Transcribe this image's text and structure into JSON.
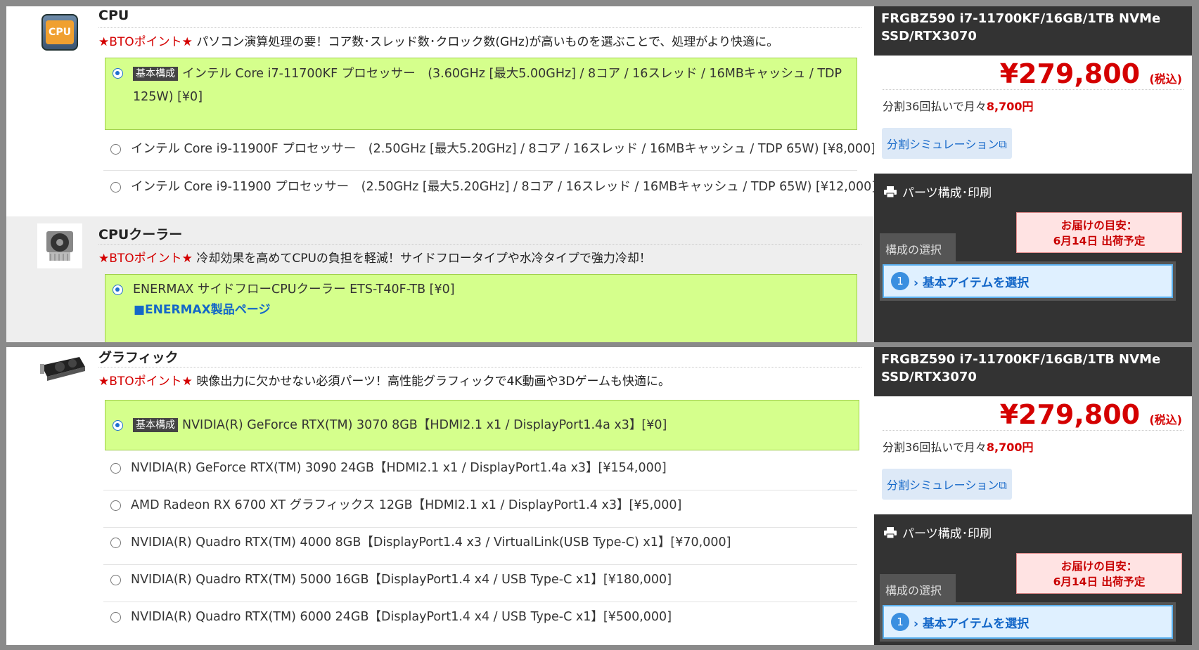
{
  "top": {
    "cpu": {
      "title": "CPU",
      "bto": "★BTOポイント★",
      "desc": "パソコン演算処理の要！コア数･スレッド数･クロック数(GHz)が高いものを選ぶことで、処理がより快適に。",
      "icon_text": "CPU",
      "base_tag": "基本構成",
      "options": [
        "インテル Core i7-11700KF プロセッサー　(3.60GHz [最大5.00GHz] / 8コア / 16スレッド / 16MBキャッシュ / TDP 125W) [¥0]",
        "インテル Core i9-11900F プロセッサー　(2.50GHz [最大5.20GHz] / 8コア / 16スレッド / 16MBキャッシュ / TDP 65W) [¥8,000]",
        "インテル Core i9-11900 プロセッサー　(2.50GHz [最大5.20GHz] / 8コア / 16スレッド / 16MBキャッシュ / TDP 65W) [¥12,000]"
      ]
    },
    "cooler": {
      "title": "CPUクーラー",
      "bto": "★BTOポイント★",
      "desc": "冷却効果を高めてCPUの負担を軽減！サイドフロータイプや水冷タイプで強力冷却！",
      "options": [
        "ENERMAX サイドフローCPUクーラー ETS-T40F-TB [¥0]"
      ],
      "link": "■ENERMAX製品ページ"
    }
  },
  "bottom": {
    "gpu": {
      "title": "グラフィック",
      "bto": "★BTOポイント★",
      "desc": "映像出力に欠かせない必須パーツ！高性能グラフィックで4K動画や3Dゲームも快適に。",
      "base_tag": "基本構成",
      "options": [
        "NVIDIA(R) GeForce RTX(TM) 3070 8GB【HDMI2.1 x1 / DisplayPort1.4a x3】[¥0]",
        "NVIDIA(R) GeForce RTX(TM) 3090 24GB【HDMI2.1 x1 / DisplayPort1.4a x3】[¥154,000]",
        "AMD Radeon RX 6700 XT グラフィックス 12GB【HDMI2.1 x1 / DisplayPort1.4 x3】[¥5,000]",
        "NVIDIA(R) Quadro RTX(TM) 4000 8GB【DisplayPort1.4 x3 / VirtualLink(USB Type-C) x1】[¥70,000]",
        "NVIDIA(R) Quadro RTX(TM) 5000 16GB【DisplayPort1.4 x4 / USB Type-C x1】[¥180,000]",
        "NVIDIA(R) Quadro RTX(TM) 6000 24GB【DisplayPort1.4 x4 / USB Type-C x1】[¥500,000]"
      ]
    }
  },
  "side": {
    "model": "FRGBZ590  i7-11700KF/16GB/1TB NVMe SSD/RTX3070",
    "price": "¥279,800",
    "tax": "(税込)",
    "split_text": "分割36回払いで月々",
    "split_amount": "8,700円",
    "sim_button": "分割シミュレーション",
    "print_label": "パーツ構成･印刷",
    "tab_label": "構成の選択",
    "delivery_line1": "お届けの目安：",
    "delivery_line2": "6月14日 出荷予定",
    "step_num": "1",
    "step_label": "› 基本アイテムを選択"
  },
  "colors": {
    "selected_bg": "#d5ff8c",
    "price_red": "#d40000",
    "link_blue": "#1467c8"
  }
}
